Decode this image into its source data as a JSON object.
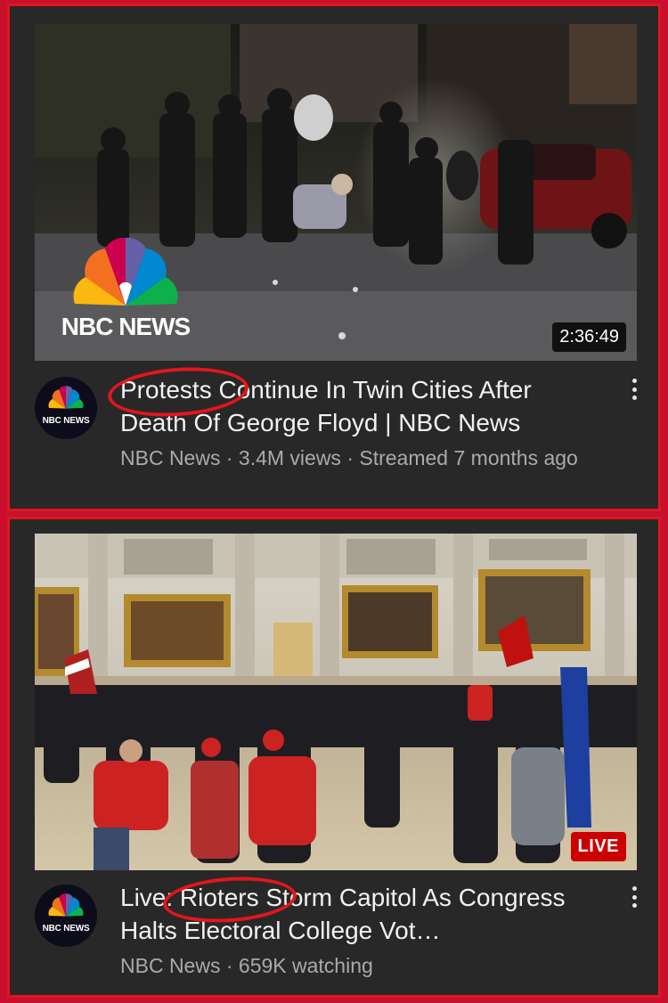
{
  "videos": [
    {
      "title": "Protests Continue In Twin Cities After Death Of George Floyd | NBC News",
      "channel": "NBC News",
      "subline": "NBC News · 3.4M views · Streamed 7 months ago",
      "badge": "2:36:49",
      "thumbnail_logo_text": "NBC NEWS",
      "avatar_text": "NBC NEWS",
      "highlighted_word": "Protests"
    },
    {
      "title": "Live: Rioters Storm Capitol As Congress Halts Electoral College Vot…",
      "channel": "NBC News",
      "subline": "NBC News · 659K watching",
      "badge": "LIVE",
      "avatar_text": "NBC NEWS",
      "highlighted_word": "Rioters"
    }
  ],
  "colors": {
    "highlight_ring": "#e2161e",
    "border": "#e0161e",
    "card_bg": "#282828",
    "live_badge": "#cc0000"
  },
  "icons": {
    "menu": "kebab-menu-icon",
    "logo": "nbc-peacock-icon"
  }
}
